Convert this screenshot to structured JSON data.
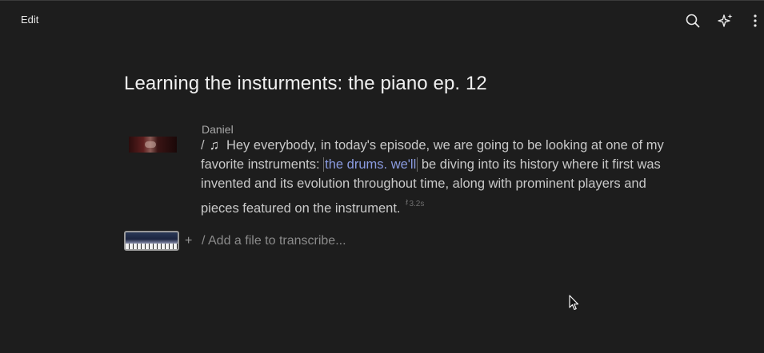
{
  "topbar": {
    "edit_label": "Edit",
    "icons": [
      "search-icon",
      "sparkle-icon",
      "more-vertical-icon"
    ]
  },
  "document": {
    "title": "Learning the insturments: the piano ep. 12"
  },
  "transcript": {
    "speaker": "Daniel",
    "slash": "/",
    "music_note": "♫",
    "text_before": "Hey everybody, in today's episode, we are going to be looking at one of my favorite instruments:",
    "highlighted_text": "the drums. we'll",
    "text_after": "be diving into its history where it first was invented and its evolution throughout time, along with prominent players and pieces featured on the instrument.",
    "pause_label": "3.2s"
  },
  "add_file": {
    "plus": "+",
    "placeholder": "/ Add a file to transcribe..."
  },
  "colors": {
    "background": "#1d1d1d",
    "highlight": "#8a9be0"
  }
}
